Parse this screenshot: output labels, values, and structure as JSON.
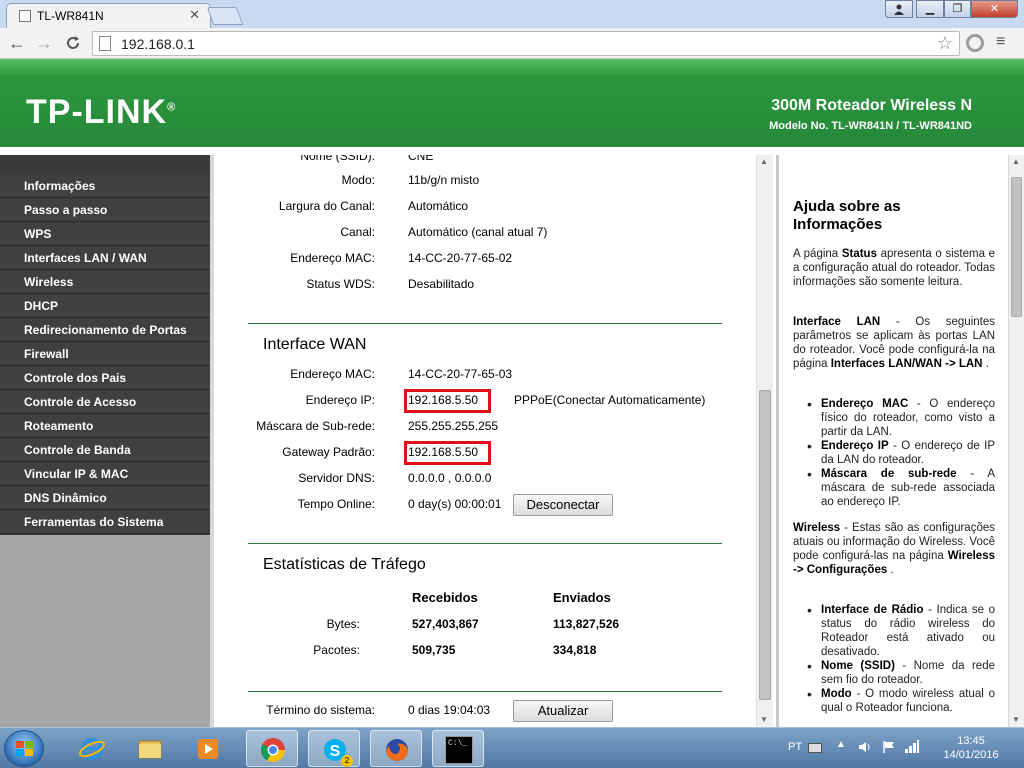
{
  "browser": {
    "tab_title": "TL-WR841N",
    "tab_close": "✕",
    "url": "192.168.0.1",
    "window_buttons": {
      "minimize": "▁",
      "maximize": "❐",
      "close": "✕",
      "user": "👤"
    },
    "nav": {
      "back": "←",
      "forward": "→",
      "reload": "C"
    },
    "star": "☆",
    "menu": "≡"
  },
  "banner": {
    "logo": "TP-LINK",
    "logo_mark": "®",
    "title": "300M Roteador Wireless N",
    "model": "Modelo No. TL-WR841N / TL-WR841ND"
  },
  "sidebar": {
    "items": [
      {
        "label": "Informações"
      },
      {
        "label": "Passo a passo"
      },
      {
        "label": "WPS"
      },
      {
        "label": "Interfaces LAN / WAN"
      },
      {
        "label": "Wireless"
      },
      {
        "label": "DHCP"
      },
      {
        "label": "Redirecionamento de Portas"
      },
      {
        "label": "Firewall"
      },
      {
        "label": "Controle dos Pais"
      },
      {
        "label": "Controle de Acesso"
      },
      {
        "label": "Roteamento"
      },
      {
        "label": "Controle de Banda"
      },
      {
        "label": "Vincular IP & MAC"
      },
      {
        "label": "DNS Dinâmico"
      },
      {
        "label": "Ferramentas do Sistema"
      }
    ]
  },
  "wireless": {
    "ssid_label": "Nome (SSID):",
    "ssid_value": "CNE",
    "mode_label": "Modo:",
    "mode_value": "11b/g/n misto",
    "width_label": "Largura do Canal:",
    "width_value": "Automático",
    "channel_label": "Canal:",
    "channel_value": "Automático (canal atual 7)",
    "mac_label": "Endereço MAC:",
    "mac_value": "14-CC-20-77-65-02",
    "wds_label": "Status WDS:",
    "wds_value": "Desabilitado"
  },
  "wan": {
    "title": "Interface WAN",
    "mac_label": "Endereço MAC:",
    "mac_value": "14-CC-20-77-65-03",
    "ip_label": "Endereço IP:",
    "ip_value": "192.168.5.50",
    "conn_type": "PPPoE(Conectar Automaticamente)",
    "mask_label": "Máscara de Sub-rede:",
    "mask_value": "255.255.255.255",
    "gateway_label": "Gateway Padrão:",
    "gateway_value": "192.168.5.50",
    "dns_label": "Servidor DNS:",
    "dns_value": "0.0.0.0 , 0.0.0.0",
    "online_label": "Tempo Online:",
    "online_value": "0 day(s) 00:00:01",
    "disconnect_button": "Desconectar"
  },
  "traffic": {
    "title": "Estatísticas de Tráfego",
    "col_received": "Recebidos",
    "col_sent": "Enviados",
    "bytes_label": "Bytes:",
    "bytes_received": "527,403,867",
    "bytes_sent": "113,827,526",
    "packets_label": "Pacotes:",
    "packets_received": "509,735",
    "packets_sent": "334,818"
  },
  "system": {
    "uptime_label": "Término do sistema:",
    "uptime_value": "0 dias 19:04:03",
    "refresh_button": "Atualizar"
  },
  "help": {
    "title": "Ajuda sobre as Informações",
    "p1_pre": "A página ",
    "p1_bold": "Status",
    "p1_post": " apresenta o sistema e a configuração atual do roteador. Todas informações são somente leitura.",
    "p2_bold1": "Interface LAN",
    "p2_mid": " - Os seguintes parâmetros se aplicam às portas LAN do roteador. Você pode configurá-la na página ",
    "p2_bold2": "Interfaces LAN/WAN -> LAN",
    "p2_end": " .",
    "li1_bold": "Endereço MAC",
    "li1_text": " - O endereço físico do roteador, como visto a partir da LAN.",
    "li2_bold": "Endereço IP",
    "li2_text": " - O endereço de IP da LAN do roteador.",
    "li3_bold": "Máscara de sub-rede",
    "li3_text": " - A máscara de sub-rede associada ao endereço IP.",
    "p3_bold1": "Wireless",
    "p3_mid": " - Estas são as configurações atuais ou informação do Wireless. Você pode configurá-las na página ",
    "p3_bold2": "Wireless -> Configurações",
    "p3_end": " .",
    "li4_bold": "Interface de Rádio",
    "li4_text": " - Indica se o status do rádio wireless do Roteador está ativado ou desativado.",
    "li5_bold": "Nome (SSID)",
    "li5_text": " - Nome da rede sem fio do roteador.",
    "li6_bold": "Modo",
    "li6_text": " - O modo wireless atual o qual o Roteador funciona."
  },
  "taskbar": {
    "language": "PT",
    "time": "13:45",
    "date": "14/01/2016",
    "skype_badge": "2",
    "cmd_text": "C:\\_"
  },
  "colors": {
    "banner_green": "#2f9a3e",
    "sidebar_dark": "#404040",
    "highlight_red": "#e0101a",
    "divider_green": "#2e7c3a"
  }
}
